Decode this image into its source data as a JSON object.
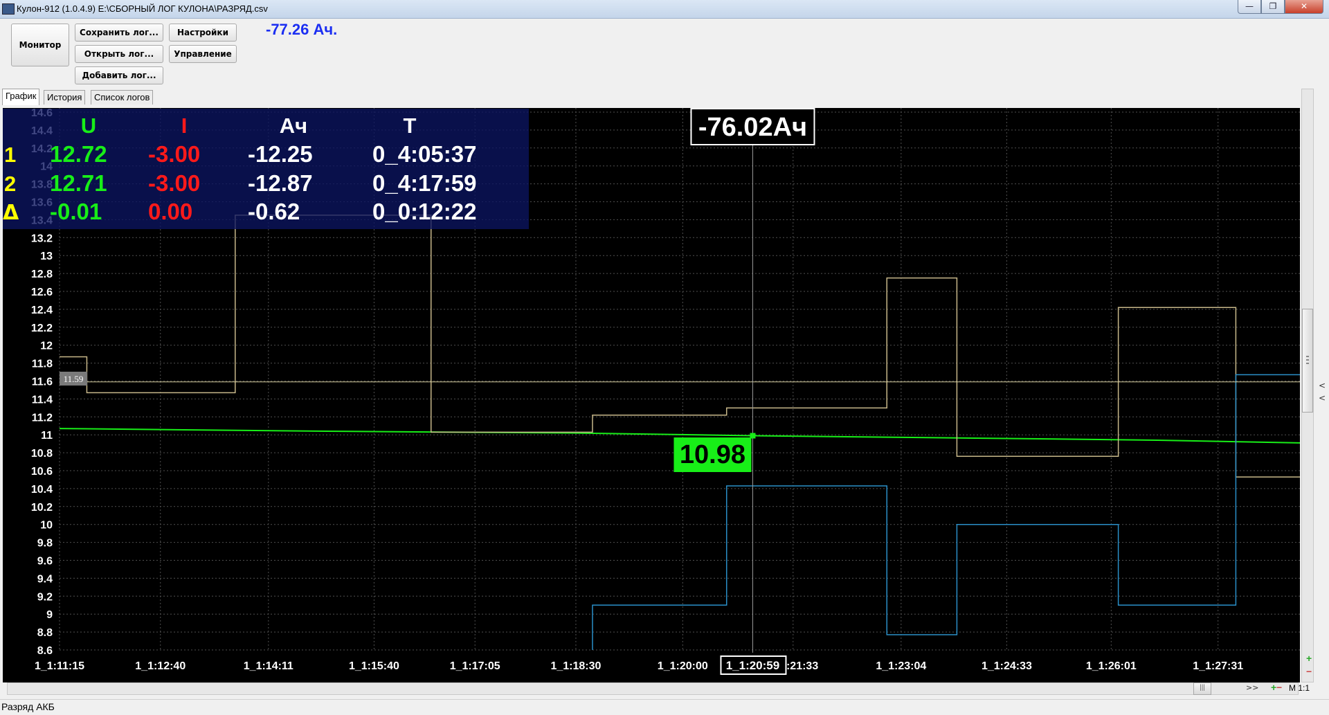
{
  "window": {
    "title": "Кулон-912 (1.0.4.9) E:\\СБОРНЫЙ ЛОГ КУЛОНА\\РАЗРЯД.csv",
    "minimize_glyph": "—",
    "maximize_glyph": "❐",
    "close_glyph": "✕"
  },
  "toolbar": {
    "monitor_label": "Монитор",
    "save_log_label": "Сохранить лог...",
    "open_log_label": "Открыть лог...",
    "add_log_label": "Добавить лог...",
    "settings_label": "Настройки",
    "control_label": "Управление",
    "total_ah": "-77.26 Ач."
  },
  "tabs": [
    {
      "label": "График",
      "active": true
    },
    {
      "label": "История",
      "active": false
    },
    {
      "label": "Список логов",
      "active": false
    }
  ],
  "overlay_table": {
    "headers": {
      "u": "U",
      "i": "I",
      "ah": "Ач",
      "t": "T"
    },
    "rows": [
      {
        "marker": "1",
        "u": "12.72",
        "i": "-3.00",
        "ah": "-12.25",
        "t": "0_4:05:37"
      },
      {
        "marker": "2",
        "u": "12.71",
        "i": "-3.00",
        "ah": "-12.87",
        "t": "0_4:17:59"
      },
      {
        "marker": "Δ",
        "u": "-0.01",
        "i": "0.00",
        "ah": "-0.62",
        "t": "0_0:12:22"
      }
    ]
  },
  "cursor": {
    "ah_label": "-76.02Ач",
    "voltage_label": "10.98",
    "time_label": "1_1:20:59",
    "left_marker_label": "11.59"
  },
  "chart_data": {
    "type": "line",
    "ylim": [
      8.6,
      14.6
    ],
    "y_ticks": [
      "8.6",
      "8.8",
      "9",
      "9.2",
      "9.4",
      "9.6",
      "9.8",
      "10",
      "10.2",
      "10.4",
      "10.6",
      "10.8",
      "11",
      "11.2",
      "11.4",
      "11.6",
      "11.8",
      "12",
      "12.2",
      "12.4",
      "12.6",
      "12.8",
      "13",
      "13.2",
      "13.4",
      "13.6",
      "13.8",
      "14",
      "14.2",
      "14.4",
      "14.6"
    ],
    "x_ticks": [
      "1_1:11:15",
      "1_1:12:40",
      "1_1:14:11",
      "1_1:15:40",
      "1_1:17:05",
      "1_1:18:30",
      "1_1:20:00",
      "1_1:21:33",
      "1_1:23:04",
      "1_1:24:33",
      "1_1:26:01",
      "1_1:27:31"
    ],
    "x_tick_seconds": [
      4275,
      4360,
      4451,
      4540,
      4625,
      4710,
      4800,
      4893,
      4984,
      5073,
      5161,
      5251
    ],
    "xlim_seconds": [
      4275,
      5320
    ],
    "cursor_seconds": 4859,
    "colors": {
      "voltage": "#18ee18",
      "tan": "#c8b88a",
      "blue": "#2a8fc8",
      "reference": "#d8d0a0",
      "grid": "#505050",
      "background": "#000000"
    },
    "series": [
      {
        "name": "",
        "color": "#18ee18",
        "points": [
          [
            4275,
            11.07
          ],
          [
            4500,
            11.04
          ],
          [
            4710,
            11.02
          ],
          [
            4859,
            10.99
          ],
          [
            5000,
            10.97
          ],
          [
            5200,
            10.94
          ],
          [
            5320,
            10.91
          ]
        ]
      },
      {
        "name": "",
        "color": "#c8b88a",
        "step_points": [
          [
            4275,
            11.87
          ],
          [
            4298,
            11.47
          ],
          [
            4423,
            13.45
          ],
          [
            4588,
            11.03
          ],
          [
            4724,
            11.22
          ],
          [
            4837,
            11.3
          ],
          [
            4972,
            12.75
          ],
          [
            5031,
            10.76
          ],
          [
            5167,
            12.42
          ],
          [
            5266,
            10.53
          ],
          [
            5320,
            10.53
          ]
        ]
      },
      {
        "name": "",
        "color": "#2a8fc8",
        "step_points": [
          [
            4724,
            8.6
          ],
          [
            4724,
            9.1
          ],
          [
            4837,
            10.43
          ],
          [
            4972,
            8.77
          ],
          [
            5031,
            10.0
          ],
          [
            5167,
            9.1
          ],
          [
            5266,
            11.67
          ],
          [
            5320,
            11.67
          ]
        ]
      },
      {
        "name": "",
        "color": "#d8d0a0",
        "constant": 11.59
      }
    ]
  },
  "status_bar": {
    "text": "Разряд АКБ"
  },
  "bottom_bar": {
    "nav": ">>",
    "plus": "+",
    "minus": "−",
    "scale": "M 1:1",
    "grip": "|||"
  },
  "side_panel": {
    "arrows": "<\n<",
    "plus": "+",
    "minus": "−"
  }
}
